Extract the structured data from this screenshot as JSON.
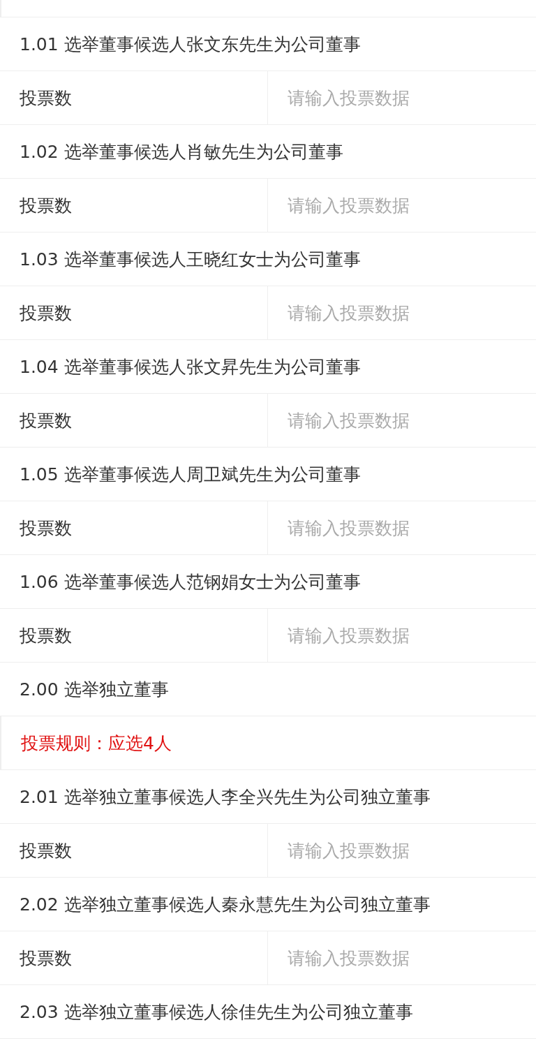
{
  "rows": [
    {
      "kind": "proposal",
      "text": "1.01 选举董事候选人张文东先生为公司董事"
    },
    {
      "kind": "vote",
      "label": "投票数",
      "placeholder": "请输入投票数据"
    },
    {
      "kind": "proposal",
      "text": "1.02 选举董事候选人肖敏先生为公司董事"
    },
    {
      "kind": "vote",
      "label": "投票数",
      "placeholder": "请输入投票数据"
    },
    {
      "kind": "proposal",
      "text": "1.03 选举董事候选人王晓红女士为公司董事"
    },
    {
      "kind": "vote",
      "label": "投票数",
      "placeholder": "请输入投票数据"
    },
    {
      "kind": "proposal",
      "text": "1.04 选举董事候选人张文昇先生为公司董事"
    },
    {
      "kind": "vote",
      "label": "投票数",
      "placeholder": "请输入投票数据"
    },
    {
      "kind": "proposal",
      "text": "1.05 选举董事候选人周卫斌先生为公司董事"
    },
    {
      "kind": "vote",
      "label": "投票数",
      "placeholder": "请输入投票数据"
    },
    {
      "kind": "proposal",
      "text": "1.06 选举董事候选人范钢娟女士为公司董事"
    },
    {
      "kind": "vote",
      "label": "投票数",
      "placeholder": "请输入投票数据"
    },
    {
      "kind": "proposal",
      "text": "2.00 选举独立董事"
    },
    {
      "kind": "rule",
      "text": "投票规则：应选4人"
    },
    {
      "kind": "proposal",
      "text": "2.01 选举独立董事候选人李全兴先生为公司独立董事"
    },
    {
      "kind": "vote",
      "label": "投票数",
      "placeholder": "请输入投票数据"
    },
    {
      "kind": "proposal",
      "text": "2.02 选举独立董事候选人秦永慧先生为公司独立董事"
    },
    {
      "kind": "vote",
      "label": "投票数",
      "placeholder": "请输入投票数据"
    },
    {
      "kind": "proposal",
      "text": "2.03 选举独立董事候选人徐佳先生为公司独立董事"
    }
  ]
}
